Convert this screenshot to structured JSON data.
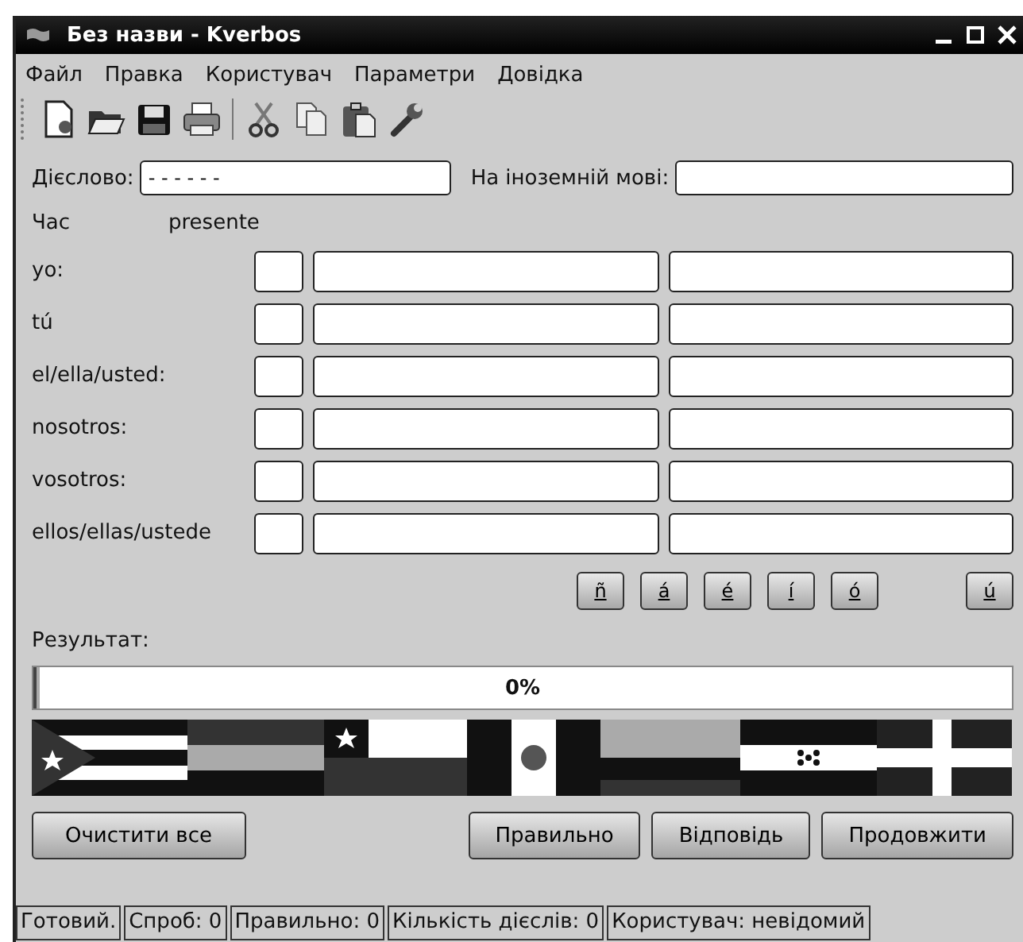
{
  "window": {
    "title": "Без назви - Kverbos"
  },
  "menu": [
    {
      "label": "Файл"
    },
    {
      "label": "Правка"
    },
    {
      "label": "Користувач"
    },
    {
      "label": "Параметри"
    },
    {
      "label": "Довідка"
    }
  ],
  "verb": {
    "label": "Дієслово:",
    "value": "- - - - - -"
  },
  "foreign": {
    "label": "На іноземній мові:"
  },
  "tense": {
    "label": "Час",
    "value": "presente"
  },
  "persons": [
    {
      "label": "yo:"
    },
    {
      "label": "tú"
    },
    {
      "label": "el/ella/usted:"
    },
    {
      "label": "nosotros:"
    },
    {
      "label": "vosotros:"
    },
    {
      "label": "ellos/ellas/ustede"
    }
  ],
  "accents": [
    "ñ",
    "á",
    "é",
    "í",
    "ó",
    "ú"
  ],
  "result": {
    "label": "Результат:",
    "level": 0,
    "reading": "0%"
  },
  "buttons": {
    "left": [
      "Очистити все"
    ],
    "right": [
      "Правильно",
      "Відповідь",
      "Продовжити"
    ]
  },
  "status_bar": [
    "Готовий.",
    "Спроб: 0",
    "Правильно: 0",
    "Кількість дієслів: 0",
    "Користувач: невідомий"
  ]
}
